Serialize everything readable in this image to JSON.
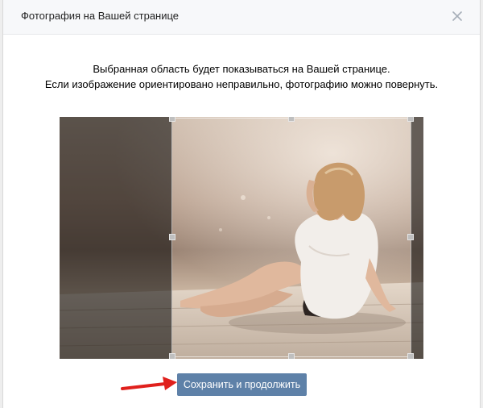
{
  "dialog": {
    "title": "Фотография на Вашей странице",
    "close_icon": "close-icon"
  },
  "description": {
    "line1": "Выбранная область будет показываться на Вашей странице.",
    "line2": "Если изображение ориентировано неправильно, фотографию можно повернуть."
  },
  "photo": {
    "subject": "photo"
  },
  "actions": {
    "save_label": "Сохранить и продолжить"
  },
  "colors": {
    "button": "#5e81a8",
    "arrow": "#e0201c"
  }
}
